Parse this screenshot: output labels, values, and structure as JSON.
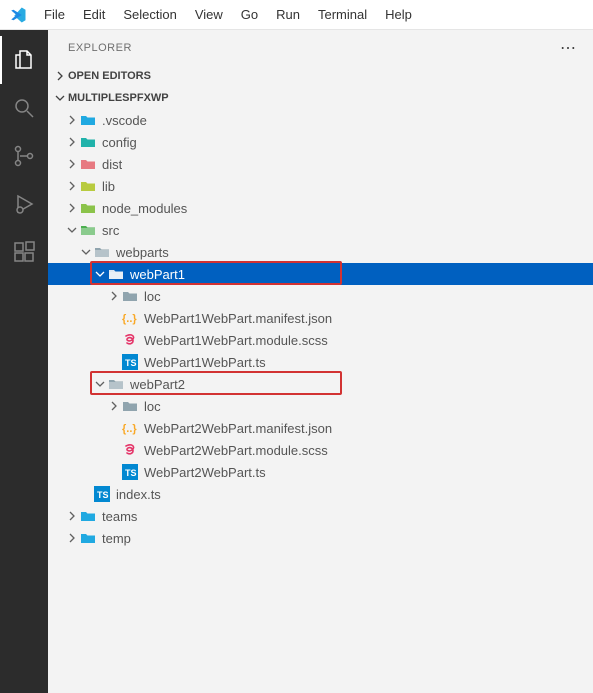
{
  "menu": {
    "items": [
      "File",
      "Edit",
      "Selection",
      "View",
      "Go",
      "Run",
      "Terminal",
      "Help"
    ]
  },
  "sidebar": {
    "title": "EXPLORER",
    "more": "⋯",
    "sections": {
      "openEditors": {
        "label": "OPEN EDITORS"
      },
      "project": {
        "label": "MULTIPLESPFXWP"
      }
    }
  },
  "activity": {
    "items": [
      "explorer",
      "search",
      "source-control",
      "run-debug",
      "extensions"
    ]
  },
  "tree": [
    {
      "depth": 0,
      "kind": "folder",
      "icon": "folder-vscode",
      "label": ".vscode",
      "chev": "right",
      "color": "#20A9E1"
    },
    {
      "depth": 0,
      "kind": "folder",
      "icon": "folder-config",
      "label": "config",
      "chev": "right",
      "color": "#20B2AA"
    },
    {
      "depth": 0,
      "kind": "folder",
      "icon": "folder-dist",
      "label": "dist",
      "chev": "right",
      "color": "#E77981"
    },
    {
      "depth": 0,
      "kind": "folder",
      "icon": "folder-lib",
      "label": "lib",
      "chev": "right",
      "color": "#B8CB3F"
    },
    {
      "depth": 0,
      "kind": "folder",
      "icon": "folder-node",
      "label": "node_modules",
      "chev": "right",
      "color": "#8BC34A"
    },
    {
      "depth": 0,
      "kind": "folder",
      "icon": "folder-src",
      "label": "src",
      "chev": "down",
      "color": "#4CAF50",
      "open": true
    },
    {
      "depth": 1,
      "kind": "folder",
      "icon": "folder",
      "label": "webparts",
      "chev": "down",
      "color": "#90A4AE",
      "open": true
    },
    {
      "depth": 2,
      "kind": "folder",
      "icon": "folder",
      "label": "webPart1",
      "chev": "down",
      "color": "#dce7f2",
      "open": true,
      "selected": true,
      "highlight": true
    },
    {
      "depth": 3,
      "kind": "folder",
      "icon": "folder",
      "label": "loc",
      "chev": "right",
      "color": "#90A4AE"
    },
    {
      "depth": 3,
      "kind": "file",
      "icon": "json",
      "label": "WebPart1WebPart.manifest.json",
      "color": "#F9A825"
    },
    {
      "depth": 3,
      "kind": "file",
      "icon": "scss",
      "label": "WebPart1WebPart.module.scss",
      "color": "#E53569"
    },
    {
      "depth": 3,
      "kind": "file",
      "icon": "ts",
      "label": "WebPart1WebPart.ts",
      "color": "#0288D1"
    },
    {
      "depth": 2,
      "kind": "folder",
      "icon": "folder",
      "label": "webPart2",
      "chev": "down",
      "color": "#90A4AE",
      "open": true,
      "highlight": true
    },
    {
      "depth": 3,
      "kind": "folder",
      "icon": "folder",
      "label": "loc",
      "chev": "right",
      "color": "#90A4AE"
    },
    {
      "depth": 3,
      "kind": "file",
      "icon": "json",
      "label": "WebPart2WebPart.manifest.json",
      "color": "#F9A825"
    },
    {
      "depth": 3,
      "kind": "file",
      "icon": "scss",
      "label": "WebPart2WebPart.module.scss",
      "color": "#E53569"
    },
    {
      "depth": 3,
      "kind": "file",
      "icon": "ts",
      "label": "WebPart2WebPart.ts",
      "color": "#0288D1"
    },
    {
      "depth": 1,
      "kind": "file",
      "icon": "ts",
      "label": "index.ts",
      "color": "#0288D1"
    },
    {
      "depth": 0,
      "kind": "folder",
      "icon": "folder",
      "label": "teams",
      "chev": "right",
      "color": "#20A9E1"
    },
    {
      "depth": 0,
      "kind": "folder",
      "icon": "folder",
      "label": "temp",
      "chev": "right",
      "color": "#20A9E1"
    }
  ]
}
